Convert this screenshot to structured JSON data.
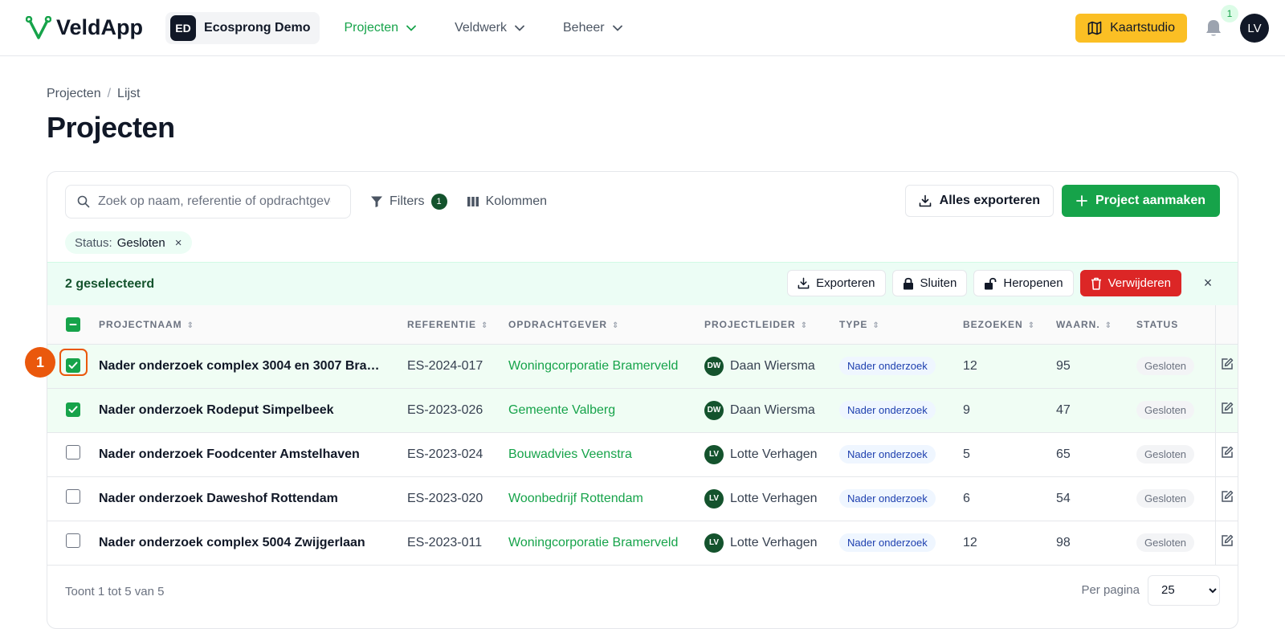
{
  "app": {
    "name": "VeldApp"
  },
  "workspace": {
    "initials": "ED",
    "name": "Ecosprong Demo"
  },
  "nav": [
    {
      "label": "Projecten",
      "active": true
    },
    {
      "label": "Veldwerk",
      "active": false
    },
    {
      "label": "Beheer",
      "active": false
    }
  ],
  "top_right": {
    "kaartstudio_label": "Kaartstudio",
    "notification_count": "1",
    "user_initials": "LV"
  },
  "breadcrumb": {
    "root": "Projecten",
    "current": "Lijst"
  },
  "page_title": "Projecten",
  "toolbar": {
    "search_placeholder": "Zoek op naam, referentie of opdrachtgever",
    "filters_label": "Filters",
    "filters_count": "1",
    "columns_label": "Kolommen",
    "export_all_label": "Alles exporteren",
    "create_label": "Project aanmaken"
  },
  "active_filter": {
    "key": "Status:",
    "value": "Gesloten",
    "remove": "×"
  },
  "bulk": {
    "selected_text": "2 geselecteerd",
    "export_label": "Exporteren",
    "close_label": "Sluiten",
    "reopen_label": "Heropenen",
    "delete_label": "Verwijderen",
    "dismiss": "×"
  },
  "columns": [
    "PROJECTNAAM",
    "REFERENTIE",
    "OPDRACHTGEVER",
    "PROJECTLEIDER",
    "TYPE",
    "BEZOEKEN",
    "WAARN.",
    "STATUS"
  ],
  "rows": [
    {
      "selected": true,
      "name": "Nader onderzoek complex 3004 en 3007 Bra…",
      "ref": "ES-2024-017",
      "client": "Woningcorporatie Bramerveld",
      "leader_initials": "DW",
      "leader": "Daan Wiersma",
      "type": "Nader onderzoek",
      "visits": "12",
      "obs": "95",
      "status": "Gesloten"
    },
    {
      "selected": true,
      "name": "Nader onderzoek Rodeput Simpelbeek",
      "ref": "ES-2023-026",
      "client": "Gemeente Valberg",
      "leader_initials": "DW",
      "leader": "Daan Wiersma",
      "type": "Nader onderzoek",
      "visits": "9",
      "obs": "47",
      "status": "Gesloten"
    },
    {
      "selected": false,
      "name": "Nader onderzoek Foodcenter Amstelhaven",
      "ref": "ES-2023-024",
      "client": "Bouwadvies Veenstra",
      "leader_initials": "LV",
      "leader": "Lotte Verhagen",
      "type": "Nader onderzoek",
      "visits": "5",
      "obs": "65",
      "status": "Gesloten"
    },
    {
      "selected": false,
      "name": "Nader onderzoek Daweshof Rottendam",
      "ref": "ES-2023-020",
      "client": "Woonbedrijf Rottendam",
      "leader_initials": "LV",
      "leader": "Lotte Verhagen",
      "type": "Nader onderzoek",
      "visits": "6",
      "obs": "54",
      "status": "Gesloten"
    },
    {
      "selected": false,
      "name": "Nader onderzoek complex 5004 Zwijgerlaan",
      "ref": "ES-2023-011",
      "client": "Woningcorporatie Bramerveld",
      "leader_initials": "LV",
      "leader": "Lotte Verhagen",
      "type": "Nader onderzoek",
      "visits": "12",
      "obs": "98",
      "status": "Gesloten"
    }
  ],
  "footer": {
    "summary": "Toont 1 tot 5 van 5",
    "per_page_label": "Per pagina",
    "per_page_value": "25"
  },
  "annotation": {
    "marker": "1"
  },
  "colors": {
    "brand_green": "#16a34a",
    "accent_yellow": "#fbbf24",
    "danger": "#dc2626",
    "marker_orange": "#ea580c"
  }
}
